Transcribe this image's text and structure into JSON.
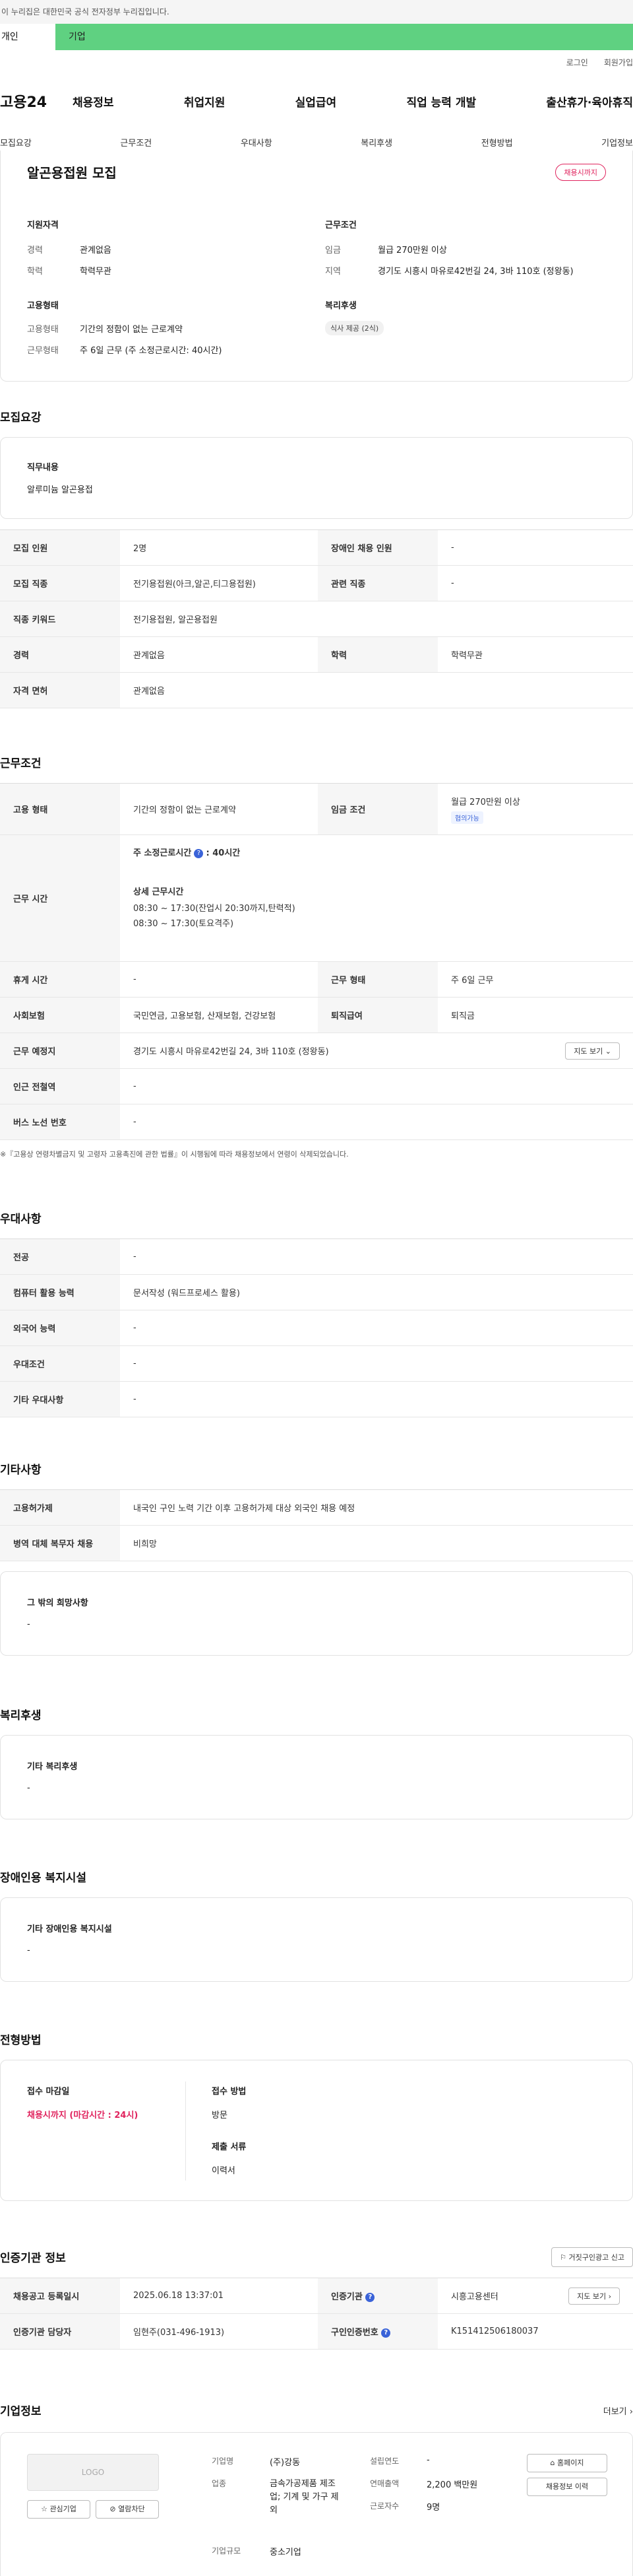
{
  "notice": "이 누리집은 대한민국 공식 전자정부 누리집입니다.",
  "audience_tabs": [
    "개인",
    "기업"
  ],
  "util_links": [
    "로그인",
    "회원가입"
  ],
  "logo": "고용24",
  "gnb": [
    "채용정보",
    "취업지원",
    "실업급여",
    "직업 능력 개발",
    "출산휴가·육아휴직"
  ],
  "subnav": [
    "모집요강",
    "근무조건",
    "우대사항",
    "복리후생",
    "전형방법",
    "기업정보"
  ],
  "summary": {
    "title": "알곤용접원 모집",
    "badge": "채용시까지",
    "qual_title": "지원자격",
    "qual": [
      {
        "k": "경력",
        "v": "관계없음"
      },
      {
        "k": "학력",
        "v": "학력무관"
      }
    ],
    "cond_title": "근무조건",
    "cond": [
      {
        "k": "임금",
        "v": "월급 270만원 이상"
      },
      {
        "k": "지역",
        "v": "경기도 시흥시 마유로42번길 24, 3바 110호 (정왕동)"
      }
    ],
    "emp_title": "고용형태",
    "emp": [
      {
        "k": "고용형태",
        "v": "기간의 정함이 없는 근로계약"
      },
      {
        "k": "근무형태",
        "v": "주 6일 근무 (주 소정근로시간: 40시간)"
      }
    ],
    "welfare_title": "복리후생",
    "welfare_tag": "식사 제공 (2식)"
  },
  "recruit": {
    "section_title": "모집요강",
    "duty_title": "직무내용",
    "duty": "알루미늄 알곤용접",
    "rows": [
      {
        "a": "모집 인원",
        "av": "2명",
        "b": "장애인 채용 인원",
        "bv": "-"
      },
      {
        "a": "모집 직종",
        "av": "전기용접원(아크,알곤,티그용접원)",
        "b": "관련 직종",
        "bv": "-"
      },
      {
        "a": "직종 키워드",
        "av": "전기용접원, 알곤용접원"
      },
      {
        "a": "경력",
        "av": "관계없음",
        "b": "학력",
        "bv": "학력무관"
      },
      {
        "a": "자격 면허",
        "av": "관계없음"
      }
    ]
  },
  "work": {
    "section_title": "근무조건",
    "emp_type_label": "고용 형태",
    "emp_type": "기간의 정함이 없는 근로계약",
    "wage_label": "임금 조건",
    "wage": "월급 270만원 이상",
    "wage_tag": "협의가능",
    "hours_label": "근무 시간",
    "hours_main": "주 소정근로시간",
    "hours_main_val": ": 40시간",
    "hours_detail_title": "상세 근무시간",
    "hours_detail": [
      "08:30 ~ 17:30(잔업시 20:30까지,탄력적)",
      "08:30 ~ 17:30(토요격주)"
    ],
    "rows": [
      {
        "a": "휴게 시간",
        "av": "-",
        "b": "근무 형태",
        "bv": "주 6일 근무"
      },
      {
        "a": "사회보험",
        "av": "국민연금, 고용보험, 산재보험, 건강보험",
        "b": "퇴직급여",
        "bv": "퇴직금"
      }
    ],
    "place_label": "근무 예정지",
    "place": "경기도 시흥시 마유로42번길 24, 3바 110호 (정왕동)",
    "map_btn": "지도 보기",
    "subway_label": "인근 전철역",
    "subway": "-",
    "bus_label": "버스 노선 번호",
    "bus": "-",
    "note": "※『고용상 연령차별금지 및 고령자 고용촉진에 관한 법률』이 시행됨에 따라 채용정보에서 연령이 삭제되었습니다."
  },
  "pref": {
    "section_title": "우대사항",
    "rows": [
      {
        "a": "전공",
        "av": "-"
      },
      {
        "a": "컴퓨터 활용 능력",
        "av": "문서작성 (워드프로세스 활용)"
      },
      {
        "a": "외국어 능력",
        "av": "-"
      },
      {
        "a": "우대조건",
        "av": "-"
      },
      {
        "a": "기타 우대사항",
        "av": "-"
      }
    ]
  },
  "etc": {
    "section_title": "기타사항",
    "rows": [
      {
        "a": "고용허가제",
        "av": "내국인 구인 노력 기간 이후 고용허가제 대상 외국인 채용 예정"
      },
      {
        "a": "병역 대체 복무자 채용",
        "av": "비희망"
      }
    ],
    "other_title": "그 밖의 희망사항",
    "other": "-"
  },
  "welfare": {
    "section_title": "복리후생",
    "box_title": "기타 복리후생",
    "box_val": "-"
  },
  "disabled": {
    "section_title": "장애인용 복지시설",
    "box_title": "기타 장애인용 복지시설",
    "box_val": "-"
  },
  "selection": {
    "section_title": "전형방법",
    "deadline_title": "접수 마감일",
    "deadline": "채용시까지 (마감시간 : 24시)",
    "method_title": "접수 방법",
    "method": "방문",
    "docs_title": "제출 서류",
    "docs": "이력서"
  },
  "agency": {
    "section_title": "인증기관 정보",
    "report_btn": "거짓구인광고 신고",
    "reg_label": "채용공고 등록일시",
    "reg": "2025.06.18 13:37:01",
    "agency_label": "인증기관",
    "agency": "시흥고용센터",
    "map_btn": "지도 보기",
    "staff_label": "인증기관 담당자",
    "staff": "임현주(031-496-1913)",
    "no_label": "구인인증번호",
    "no": "K151412506180037"
  },
  "company": {
    "section_title": "기업정보",
    "more": "더보기",
    "logo": "LOGO",
    "fav_btn": "관심기업",
    "block_btn": "열람차단",
    "fields": [
      {
        "k": "기업명",
        "v": "(주)강동"
      },
      {
        "k": "업종",
        "v": "금속가공제품 제조업; 기계 및 가구 제외"
      },
      {
        "k": "기업규모",
        "v": "중소기업"
      }
    ],
    "fields2": [
      {
        "k": "설립연도",
        "v": "-"
      },
      {
        "k": "연매출액",
        "v": "2,200 백만원"
      },
      {
        "k": "근로자수",
        "v": "9명"
      }
    ],
    "home_btn": "홈페이지",
    "history_btn": "채용정보 이력"
  }
}
